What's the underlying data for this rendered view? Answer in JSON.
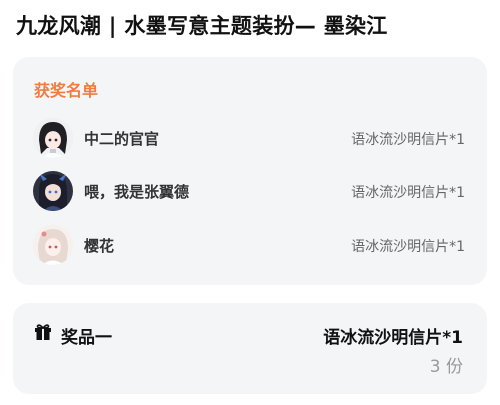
{
  "header": {
    "title": "九龙风潮 | 水墨写意主题装扮— 墨染江"
  },
  "winners": {
    "label": "获奖名单",
    "label_color": "#f07c42",
    "items": [
      {
        "name": "中二的官官",
        "prize": "语冰流沙明信片*1"
      },
      {
        "name": "喂，我是张翼德",
        "prize": "语冰流沙明信片*1"
      },
      {
        "name": "樱花",
        "prize": "语冰流沙明信片*1"
      }
    ]
  },
  "prize": {
    "icon": "gift-icon",
    "tier": "奖品一",
    "name": "语冰流沙明信片*1",
    "quantity": "3 份"
  }
}
